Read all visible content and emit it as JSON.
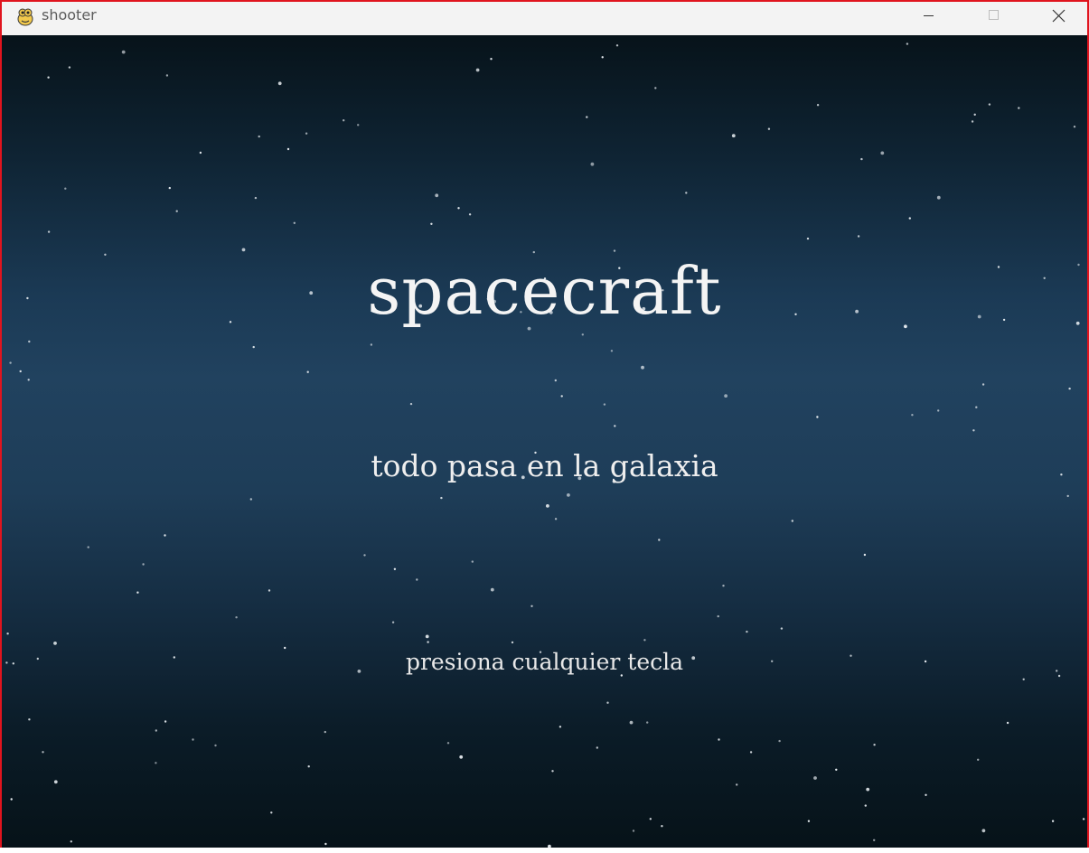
{
  "window": {
    "title": "shooter",
    "icon": "pygame-snake-icon",
    "controls": [
      "minimize-icon",
      "maximize-icon",
      "close-icon"
    ]
  },
  "game": {
    "title": "spacecraft",
    "subtitle": "todo pasa en la galaxia",
    "prompt": "presiona cualquier tecla"
  },
  "colors": {
    "window_border": "#e0141e",
    "titlebar_bg": "#f3f3f3",
    "sky_top": "#07131a",
    "sky_mid": "#21425f",
    "sky_bottom": "#061218",
    "text": "#f4f4f4"
  }
}
